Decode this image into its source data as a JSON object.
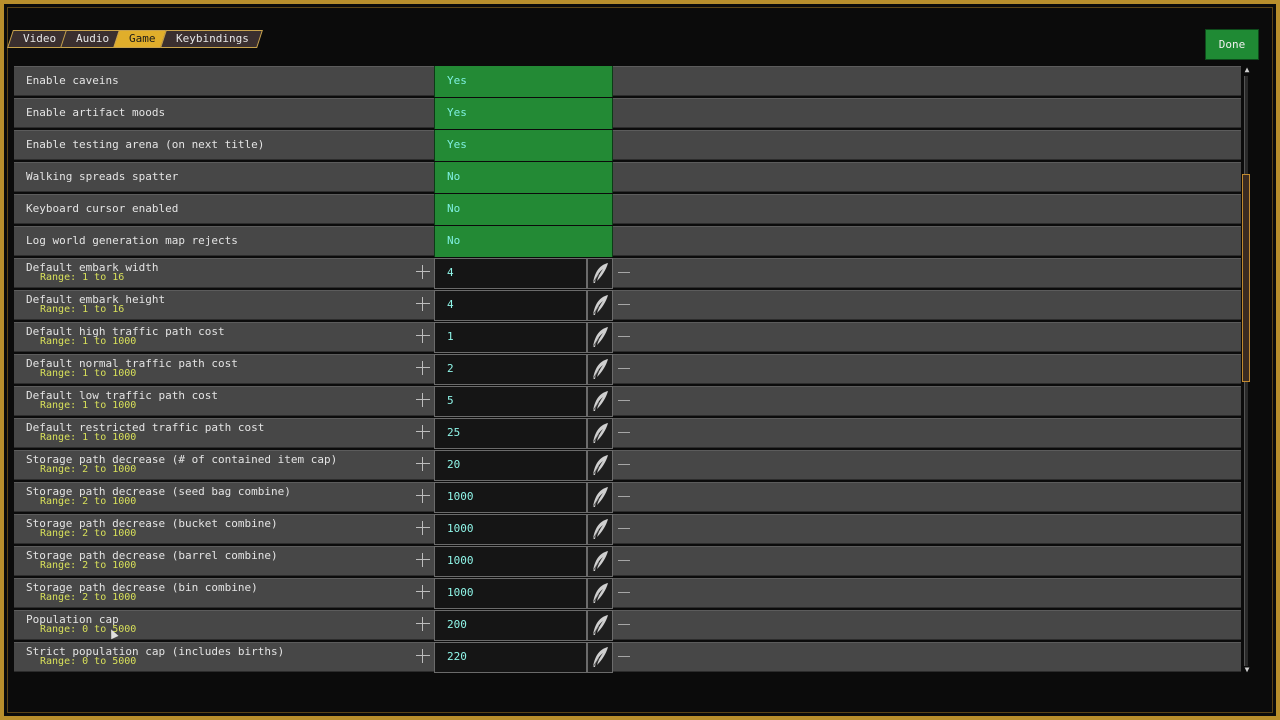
{
  "tabs": [
    {
      "label": "Video",
      "active": false
    },
    {
      "label": "Audio",
      "active": false
    },
    {
      "label": "Game",
      "active": true
    },
    {
      "label": "Keybindings",
      "active": false
    }
  ],
  "done_label": "Done",
  "colors": {
    "frame": "#b98f2c",
    "active_tab": "#e0ae2b",
    "toggle_green": "#238a35",
    "value_text": "#8ff5e8",
    "range_text": "#d8e05a",
    "row_bg": "#474747"
  },
  "toggles": [
    {
      "label": "Enable caveins",
      "value": "Yes"
    },
    {
      "label": "Enable artifact moods",
      "value": "Yes"
    },
    {
      "label": "Enable testing arena (on next title)",
      "value": "Yes"
    },
    {
      "label": "Walking spreads spatter",
      "value": "No"
    },
    {
      "label": "Keyboard cursor enabled",
      "value": "No"
    },
    {
      "label": "Log world generation map rejects",
      "value": "No"
    }
  ],
  "numeric": [
    {
      "label": "Default embark width",
      "range": "Range: 1 to 16",
      "value": "4"
    },
    {
      "label": "Default embark height",
      "range": "Range: 1 to 16",
      "value": "4"
    },
    {
      "label": "Default high traffic path cost",
      "range": "Range: 1 to 1000",
      "value": "1"
    },
    {
      "label": "Default normal traffic path cost",
      "range": "Range: 1 to 1000",
      "value": "2"
    },
    {
      "label": "Default low traffic path cost",
      "range": "Range: 1 to 1000",
      "value": "5"
    },
    {
      "label": "Default restricted traffic path cost",
      "range": "Range: 1 to 1000",
      "value": "25"
    },
    {
      "label": "Storage path decrease (# of contained item cap)",
      "range": "Range: 2 to 1000",
      "value": "20"
    },
    {
      "label": "Storage path decrease (seed bag combine)",
      "range": "Range: 2 to 1000",
      "value": "1000"
    },
    {
      "label": "Storage path decrease (bucket combine)",
      "range": "Range: 2 to 1000",
      "value": "1000"
    },
    {
      "label": "Storage path decrease (barrel combine)",
      "range": "Range: 2 to 1000",
      "value": "1000"
    },
    {
      "label": "Storage path decrease (bin combine)",
      "range": "Range: 2 to 1000",
      "value": "1000"
    },
    {
      "label": "Population cap",
      "range": "Range: 0 to 5000",
      "value": "200"
    },
    {
      "label": "Strict population cap (includes births)",
      "range": "Range: 0 to 5000",
      "value": "220"
    }
  ],
  "icons": {
    "edit": "quill-icon",
    "increment": "plus-icon",
    "decrement": "minus-icon",
    "scroll_up": "arrow-up-icon",
    "scroll_down": "arrow-down-icon"
  }
}
